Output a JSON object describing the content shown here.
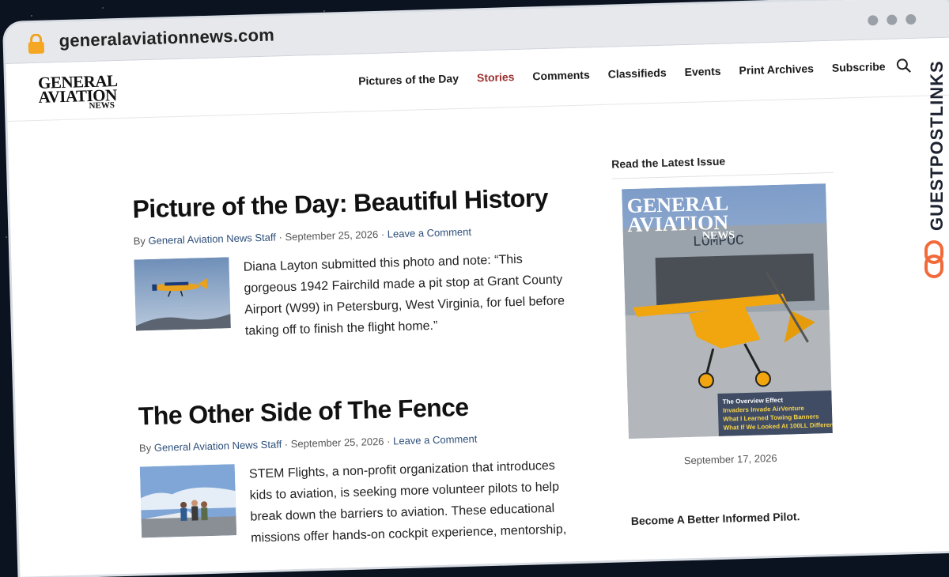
{
  "browser": {
    "url": "generalaviationnews.com",
    "icons": [
      "lock-icon"
    ]
  },
  "site": {
    "logo": {
      "line1": "GENERAL",
      "line2": "AVIATION",
      "line3": "NEWS"
    },
    "nav": [
      {
        "label": "Pictures of the Day",
        "active": false
      },
      {
        "label": "Stories",
        "active": true
      },
      {
        "label": "Comments",
        "active": false
      },
      {
        "label": "Classifieds",
        "active": false
      },
      {
        "label": "Events",
        "active": false
      },
      {
        "label": "Print Archives",
        "active": false
      },
      {
        "label": "Subscribe",
        "active": false
      }
    ],
    "colors": {
      "nav_active": "#9b2f2f",
      "link": "#2d4f7a"
    }
  },
  "posts": [
    {
      "title": "Picture of the Day: Beautiful History",
      "by": "By",
      "author": "General Aviation News Staff",
      "date": "September 25, 2026",
      "comment": "Leave a Comment",
      "excerpt": "Diana Layton submitted this photo and note: “This gorgeous 1942 Fairchild made a pit stop at Grant County Airport (W99) in Petersburg, West Virginia, for fuel before taking off to finish the flight home.”"
    },
    {
      "title": "The Other Side of The Fence",
      "by": "By",
      "author": "General Aviation News Staff",
      "date": "September 25, 2026",
      "comment": "Leave a Comment",
      "excerpt": "STEM Flights, a non-profit organization that introduces kids to aviation, is seeking more volunteer pilots to help break down the barriers to aviation. These educational missions offer hands-on cockpit experience, mentorship,"
    }
  ],
  "sidebar": {
    "heading": "Read the Latest Issue",
    "cover": {
      "masthead1": "GENERAL",
      "masthead2": "AVIATION",
      "masthead3": "NEWS",
      "hangar_sign": "LOMPOC",
      "headlines": [
        "The Overview Effect",
        "Invaders Invade AirVenture",
        "What I Learned Towing Banners",
        "What If We Looked At 100LL Differently?"
      ]
    },
    "issue_date": "September 17, 2026",
    "cta": "Become A Better Informed Pilot."
  },
  "watermark": {
    "text": "GUESTPOSTLINKS"
  }
}
